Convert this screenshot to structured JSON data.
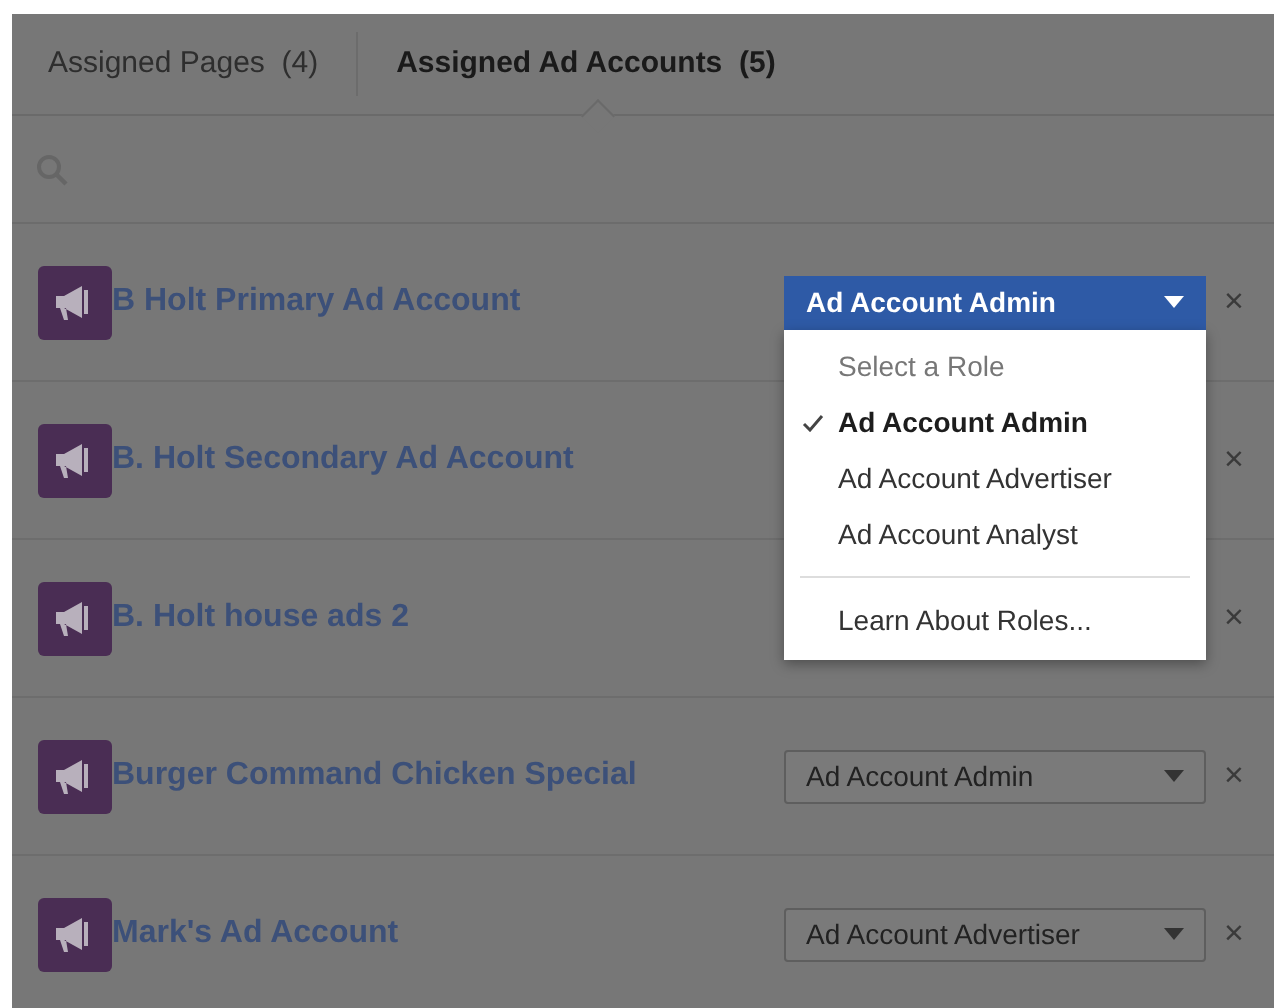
{
  "tabs": [
    {
      "label": "Assigned Pages",
      "count": "(4)",
      "selected": false
    },
    {
      "label": "Assigned Ad Accounts",
      "count": "(5)",
      "selected": true
    }
  ],
  "accounts": [
    {
      "name": "B Holt Primary Ad Account",
      "role": "Ad Account Admin",
      "open": true,
      "remove": "×"
    },
    {
      "name": "B. Holt Secondary Ad Account",
      "remove": "×"
    },
    {
      "name": "B. Holt house ads 2",
      "remove": "×"
    },
    {
      "name": "Burger Command Chicken Special",
      "role": "Ad Account Admin",
      "open": false,
      "remove": "×"
    },
    {
      "name": "Mark's Ad Account",
      "role": "Ad Account Advertiser",
      "open": false,
      "remove": "×"
    }
  ],
  "role_menu": {
    "items": [
      {
        "kind": "header",
        "label": "Select a Role"
      },
      {
        "kind": "option",
        "label": "Ad Account Admin",
        "selected": true
      },
      {
        "kind": "option",
        "label": "Ad Account Advertiser",
        "selected": false
      },
      {
        "kind": "option",
        "label": "Ad Account Analyst",
        "selected": false
      },
      {
        "kind": "divider"
      },
      {
        "kind": "link",
        "label": "Learn About Roles..."
      }
    ]
  }
}
